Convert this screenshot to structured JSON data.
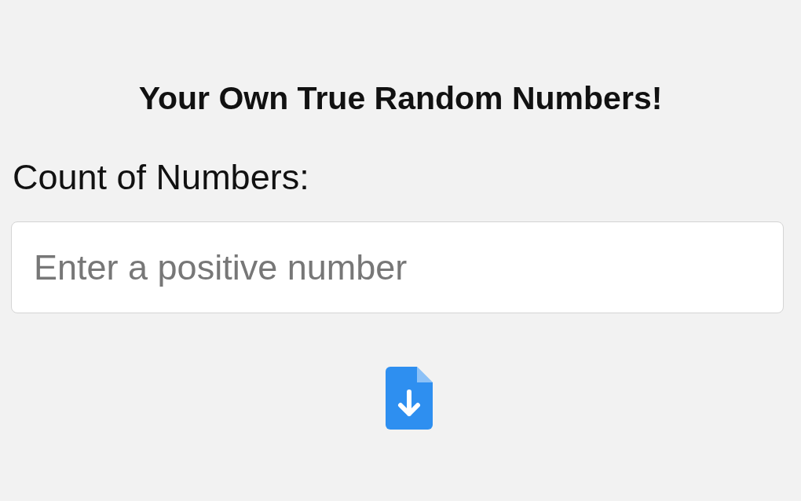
{
  "title": "Your Own True Random Numbers!",
  "count_field": {
    "label": "Count of Numbers:",
    "placeholder": "Enter a positive number"
  }
}
